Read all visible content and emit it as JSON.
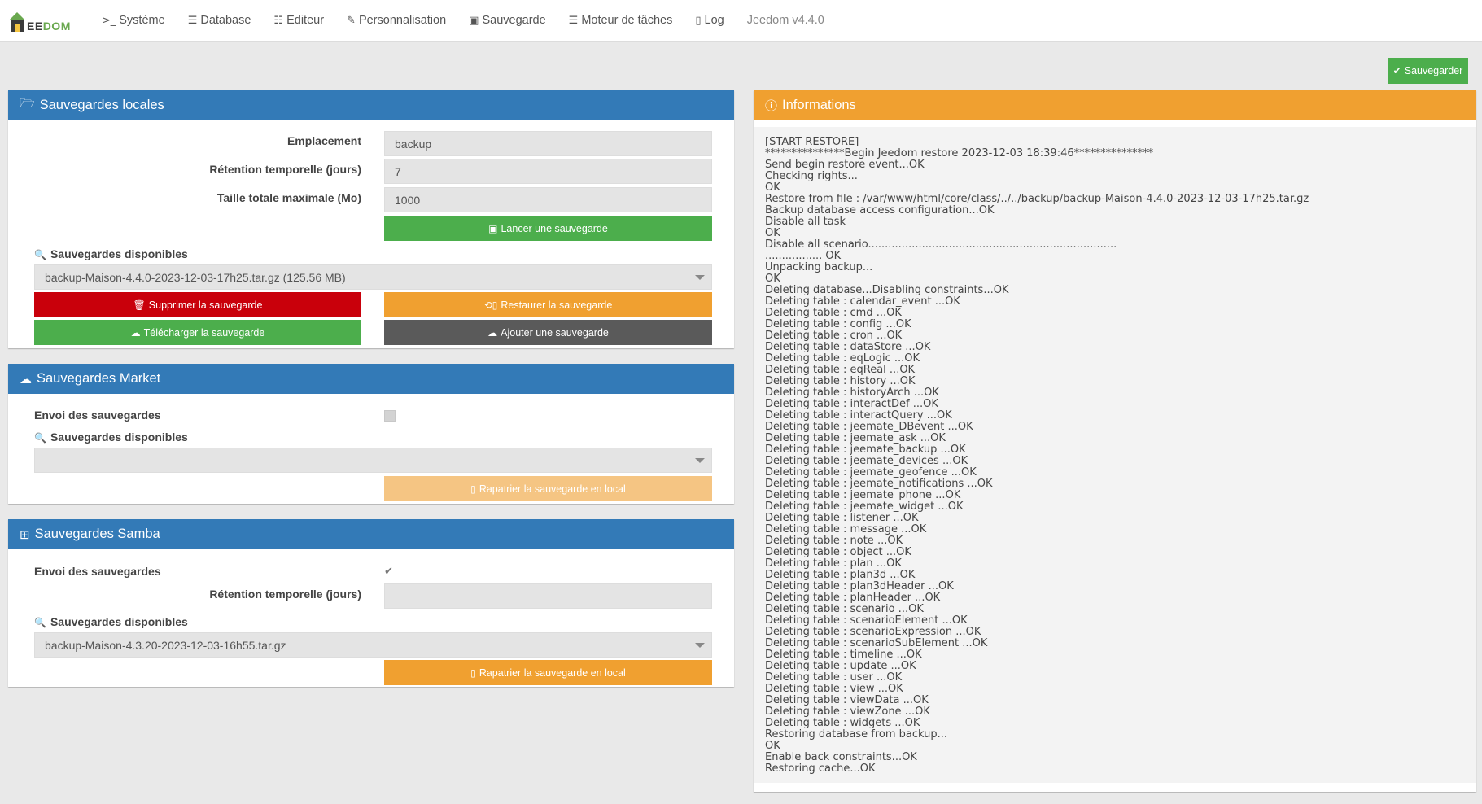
{
  "nav": {
    "logo_left": "J",
    "logo_text_a": "EE",
    "logo_text_b": "DOM",
    "items": [
      {
        "label": "Système",
        "icon": "terminal-icon",
        "glyph": ">_"
      },
      {
        "label": "Database",
        "icon": "database-icon",
        "glyph": "☰"
      },
      {
        "label": "Editeur",
        "icon": "editor-icon",
        "glyph": "☷"
      },
      {
        "label": "Personnalisation",
        "icon": "edit-icon",
        "glyph": "✎"
      },
      {
        "label": "Sauvegarde",
        "icon": "save-icon",
        "glyph": "▣"
      },
      {
        "label": "Moteur de tâches",
        "icon": "list-icon",
        "glyph": "☰"
      },
      {
        "label": "Log",
        "icon": "file-icon",
        "glyph": "▯"
      }
    ],
    "version": "Jeedom v4.4.0"
  },
  "top_save_button": "Sauvegarder",
  "local": {
    "title": "Sauvegardes locales",
    "location_label": "Emplacement",
    "location_value": "backup",
    "retention_label": "Rétention temporelle (jours)",
    "retention_value": "7",
    "max_size_label": "Taille totale maximale (Mo)",
    "max_size_value": "1000",
    "launch_button": "Lancer une sauvegarde",
    "available_label": "Sauvegardes disponibles",
    "selected_backup": "backup-Maison-4.4.0-2023-12-03-17h25.tar.gz (125.56 MB)",
    "delete_button": "Supprimer la sauvegarde",
    "restore_button": "Restaurer la sauvegarde",
    "download_button": "Télécharger la sauvegarde",
    "add_button": "Ajouter une sauvegarde"
  },
  "market": {
    "title": "Sauvegardes Market",
    "send_label": "Envoi des sauvegardes",
    "send_checked": false,
    "available_label": "Sauvegardes disponibles",
    "selected_backup": "",
    "repatriate_button": "Rapatrier la sauvegarde en local"
  },
  "samba": {
    "title": "Sauvegardes Samba",
    "send_label": "Envoi des sauvegardes",
    "send_checked": true,
    "retention_label": "Rétention temporelle (jours)",
    "retention_value": "",
    "available_label": "Sauvegardes disponibles",
    "selected_backup": "backup-Maison-4.3.20-2023-12-03-16h55.tar.gz",
    "repatriate_button": "Rapatrier la sauvegarde en local"
  },
  "info": {
    "title": "Informations",
    "log": [
      "[START RESTORE]",
      "***************Begin Jeedom restore 2023-12-03 18:39:46***************",
      "Send begin restore event...OK",
      "Checking rights...",
      "OK",
      "Restore from file : /var/www/html/core/class/../../backup/backup-Maison-4.4.0-2023-12-03-17h25.tar.gz",
      "Backup database access configuration...OK",
      "Disable all task",
      "OK",
      "Disable all scenario..........................................................................",
      "................. OK",
      "Unpacking backup...",
      "OK",
      "Deleting database...Disabling constraints...OK",
      "Deleting table : calendar_event ...OK",
      "Deleting table : cmd ...OK",
      "Deleting table : config ...OK",
      "Deleting table : cron ...OK",
      "Deleting table : dataStore ...OK",
      "Deleting table : eqLogic ...OK",
      "Deleting table : eqReal ...OK",
      "Deleting table : history ...OK",
      "Deleting table : historyArch ...OK",
      "Deleting table : interactDef ...OK",
      "Deleting table : interactQuery ...OK",
      "Deleting table : jeemate_DBevent ...OK",
      "Deleting table : jeemate_ask ...OK",
      "Deleting table : jeemate_backup ...OK",
      "Deleting table : jeemate_devices ...OK",
      "Deleting table : jeemate_geofence ...OK",
      "Deleting table : jeemate_notifications ...OK",
      "Deleting table : jeemate_phone ...OK",
      "Deleting table : jeemate_widget ...OK",
      "Deleting table : listener ...OK",
      "Deleting table : message ...OK",
      "Deleting table : note ...OK",
      "Deleting table : object ...OK",
      "Deleting table : plan ...OK",
      "Deleting table : plan3d ...OK",
      "Deleting table : plan3dHeader ...OK",
      "Deleting table : planHeader ...OK",
      "Deleting table : scenario ...OK",
      "Deleting table : scenarioElement ...OK",
      "Deleting table : scenarioExpression ...OK",
      "Deleting table : scenarioSubElement ...OK",
      "Deleting table : timeline ...OK",
      "Deleting table : update ...OK",
      "Deleting table : user ...OK",
      "Deleting table : view ...OK",
      "Deleting table : viewData ...OK",
      "Deleting table : viewZone ...OK",
      "Deleting table : widgets ...OK",
      "Restoring database from backup...",
      "OK",
      "Enable back constraints...OK",
      "Restoring cache...OK"
    ]
  },
  "colors": {
    "primary": "#337ab7",
    "warning": "#f0a030",
    "success": "#4cae4c",
    "danger": "#c9000b",
    "dark": "#5a5a5a"
  }
}
